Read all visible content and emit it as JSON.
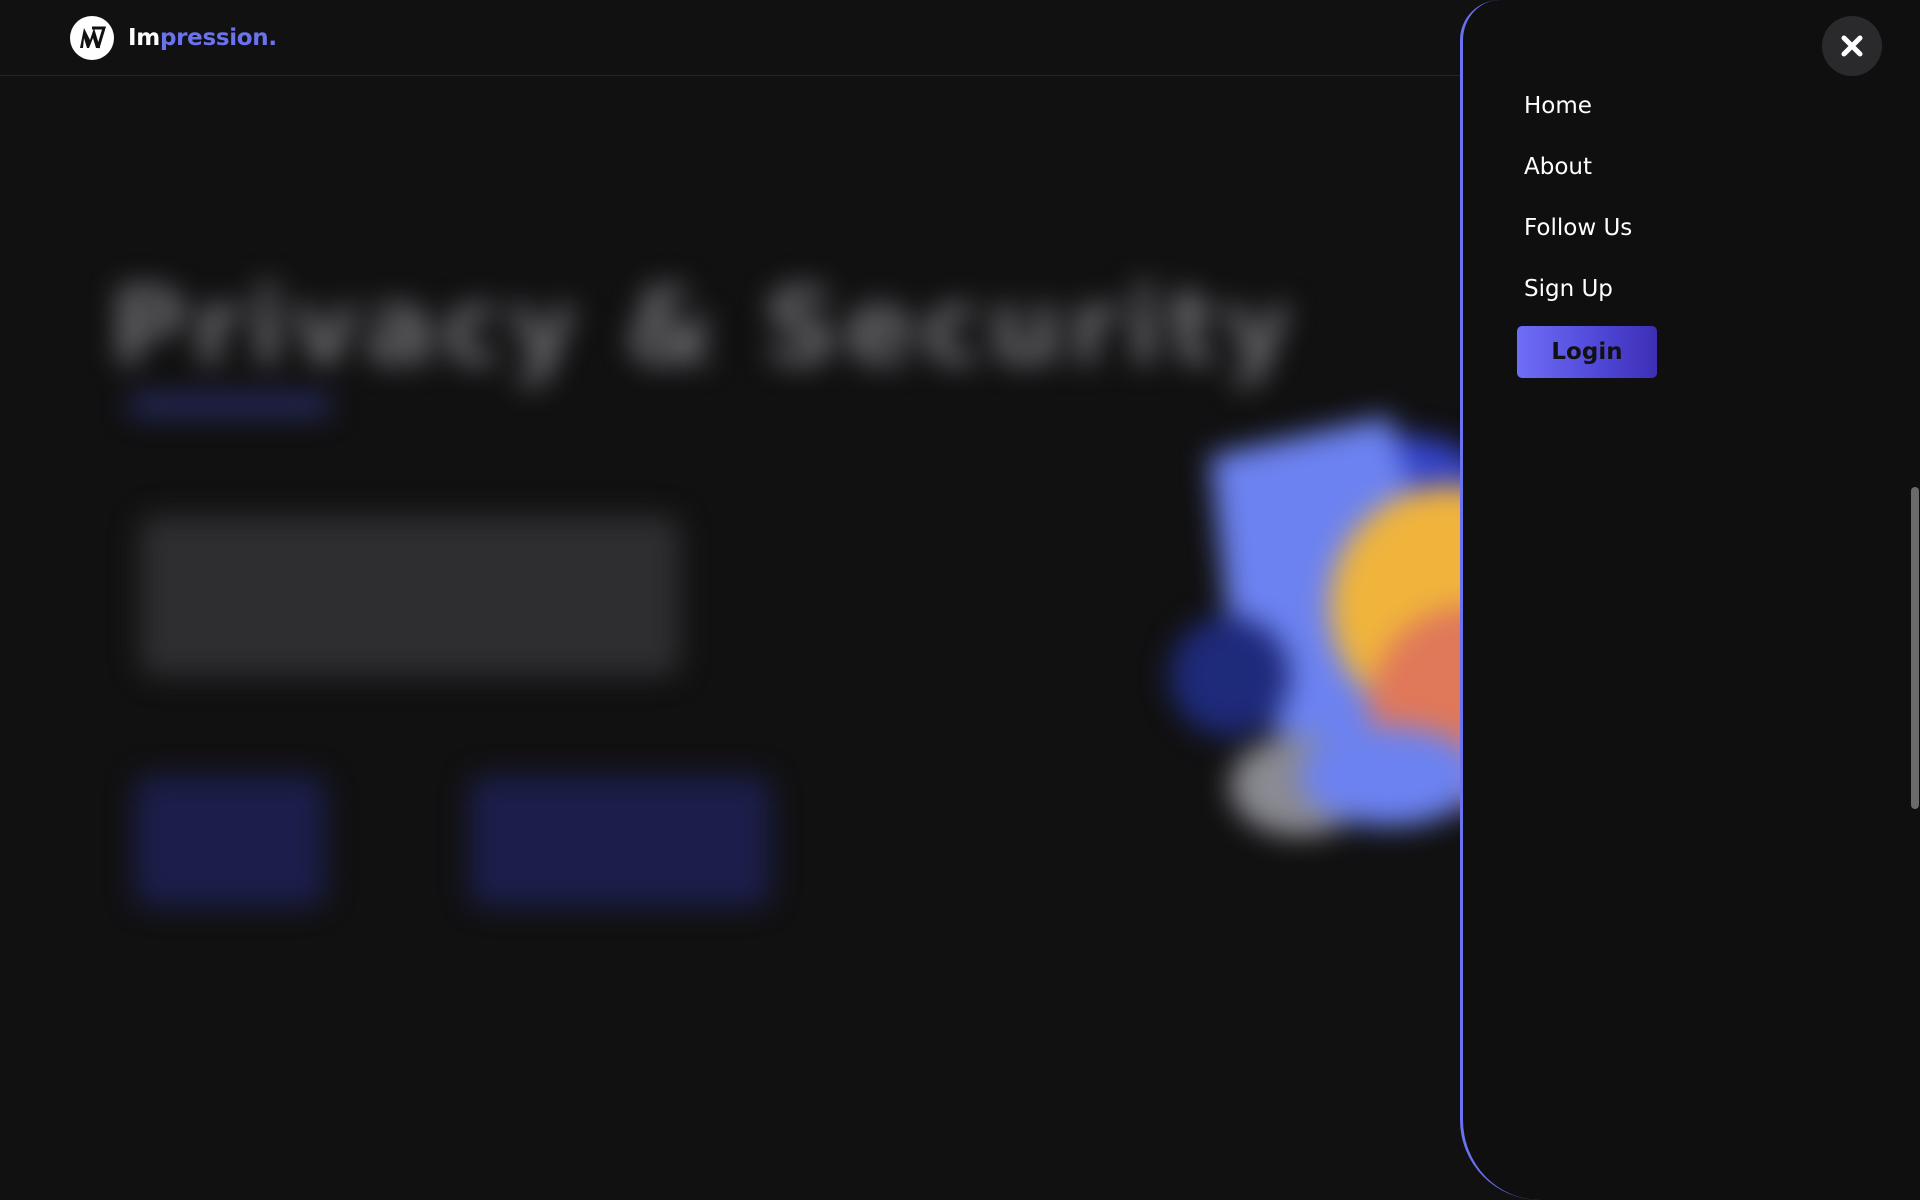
{
  "brand": {
    "name_part1": "Im",
    "name_part2": "pression."
  },
  "background": {
    "hero_title": "Privacy & Security"
  },
  "drawer": {
    "nav_items": [
      "Home",
      "About",
      "Follow Us",
      "Sign Up"
    ],
    "login_label": "Login",
    "close_icon": "close-icon"
  },
  "colors": {
    "accent": "#6b72f0",
    "background": "#111112",
    "drawer_background": "#0f0f10"
  }
}
